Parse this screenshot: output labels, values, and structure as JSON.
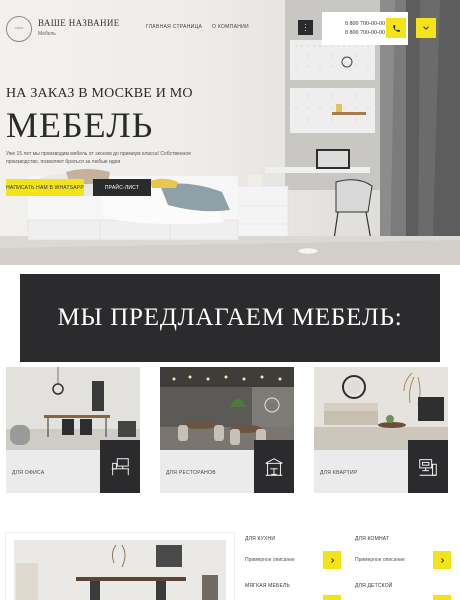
{
  "header": {
    "logo_text": "LOGO",
    "brand_name": "ВАШЕ НАЗВАНИЕ",
    "brand_sub": "Мебель",
    "nav": [
      "ГЛАВНАЯ СТРАНИЦА",
      "О КОМПАНИИ"
    ],
    "phones": [
      "8 800 700-00-00",
      "8 800 700-00-00"
    ]
  },
  "hero": {
    "kicker": "НА ЗАКАЗ В МОСКВЕ И МО",
    "title": "МЕБЕЛЬ",
    "text": "Уже 15 лет мы производим мебель от эконом до премиум класса! Собственное производство, позволяет браться за любые идеи",
    "primary_button": "НАПИСАТЬ НАМ В WHATSAPP",
    "secondary_button": "ПРАЙС-ЛИСТ"
  },
  "offer": {
    "title": "МЫ ПРЕДЛАГАЕМ МЕБЕЛЬ:",
    "cards": [
      {
        "label": "ДЛЯ ОФИСА",
        "icon": "office-desk-icon"
      },
      {
        "label": "ДЛЯ РЕСТОРАНОВ",
        "icon": "restaurant-icon"
      },
      {
        "label": "ДЛЯ КВАРТИР",
        "icon": "apartment-icon"
      }
    ]
  },
  "categories": [
    {
      "title": "ДЛЯ КУХНИ",
      "desc": "Примерное описание"
    },
    {
      "title": "ДЛЯ КОМНАТ",
      "desc": "Примерное описание"
    },
    {
      "title": "МЯГКАЯ МЕБЕЛЬ",
      "desc": ""
    },
    {
      "title": "ДЛЯ ДЕТСКОЙ",
      "desc": ""
    }
  ],
  "colors": {
    "accent": "#f3e31a",
    "dark": "#2b2b2d",
    "card": "#ebebeb"
  }
}
